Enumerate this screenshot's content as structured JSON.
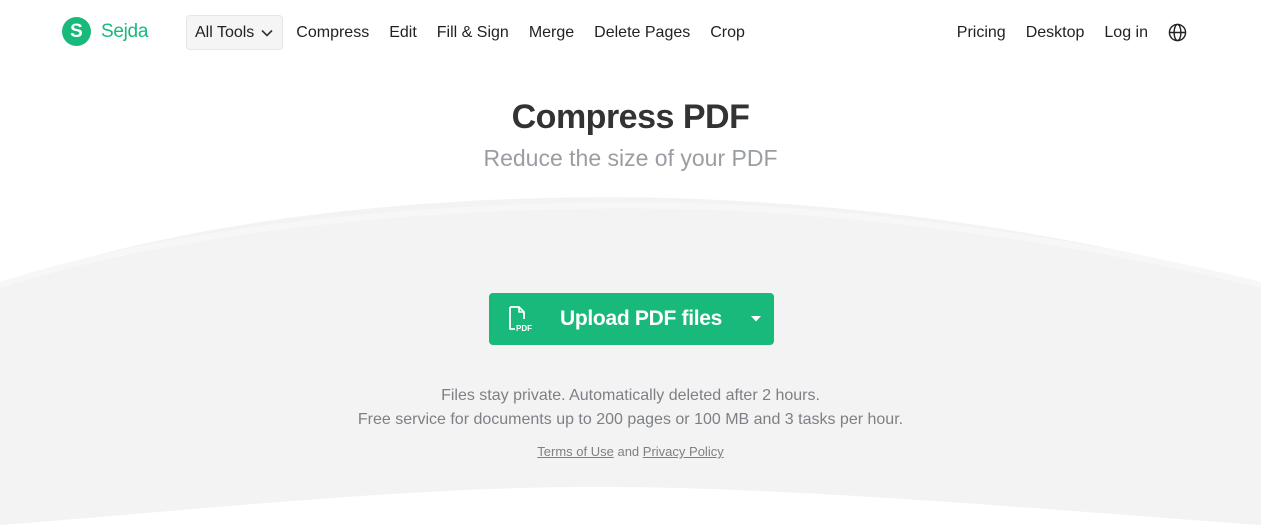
{
  "brand": {
    "name": "Sejda",
    "mark": "S",
    "color": "#19b97b"
  },
  "nav": {
    "all_tools": "All Tools",
    "links": [
      "Compress",
      "Edit",
      "Fill & Sign",
      "Merge",
      "Delete Pages",
      "Crop"
    ],
    "right": {
      "pricing": "Pricing",
      "desktop": "Desktop",
      "login": "Log in",
      "language_icon": "globe-icon"
    }
  },
  "header": {
    "title": "Compress PDF",
    "subtitle": "Reduce the size of your PDF"
  },
  "upload": {
    "label": "Upload PDF files",
    "icon": "pdf-file-icon",
    "icon_text": "PDF",
    "dropdown_icon": "caret-down-icon"
  },
  "notes": {
    "line1": "Files stay private. Automatically deleted after 2 hours.",
    "line2": "Free service for documents up to 200 pages or 100 MB and 3 tasks per hour."
  },
  "legal": {
    "terms": "Terms of Use",
    "and": "and",
    "privacy": "Privacy Policy"
  }
}
